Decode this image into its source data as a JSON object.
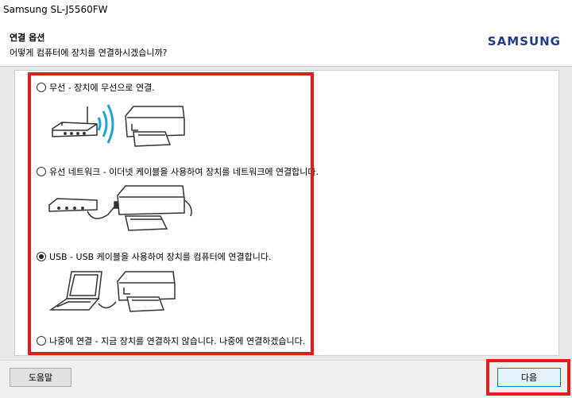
{
  "window": {
    "title": "Samsung SL-J5560FW"
  },
  "header": {
    "heading": "연결 옵션",
    "question": "어떻게 컴퓨터에 장치를 연결하시겠습니까?",
    "logo": "SAMSUNG"
  },
  "options": [
    {
      "label": "무선 - 장치에 무선으로 연결.",
      "selected": false
    },
    {
      "label": "유선 네트워크 - 이더넷 케이블을 사용하여 장치를 네트워크에 연결합니다.",
      "selected": false
    },
    {
      "label": "USB - USB 케이블을 사용하여 장치를 컴퓨터에 연결합니다.",
      "selected": true
    },
    {
      "label": "나중에 연결 - 지금 장치를 연결하지 않습니다. 나중에 연결하겠습니다.",
      "selected": false
    }
  ],
  "footer": {
    "help_label": "도움말",
    "next_label": "다음"
  },
  "colors": {
    "highlight": "#e21b1b",
    "logo": "#1f3c8c",
    "wifi": "#1aa3dd"
  }
}
